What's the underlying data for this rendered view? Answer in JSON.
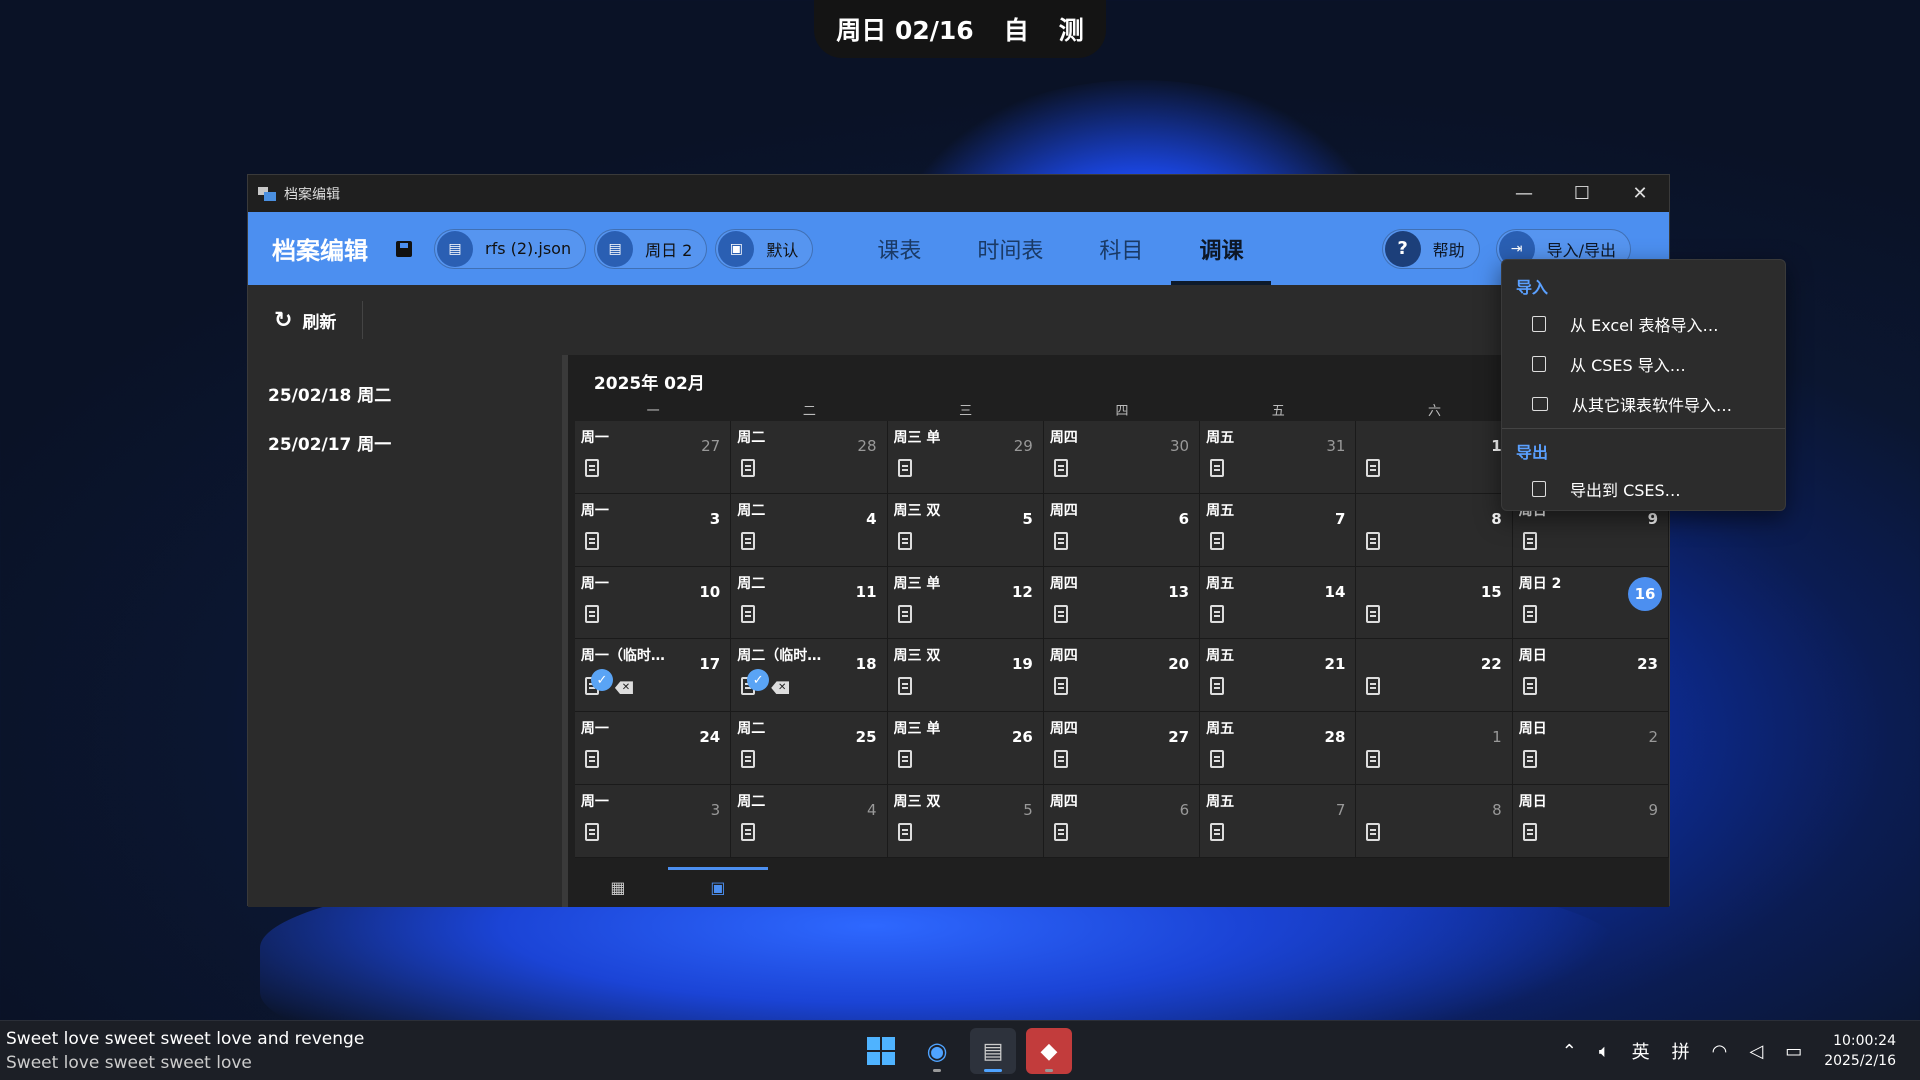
{
  "top_pill": {
    "date": "周日 02/16",
    "c1": "自",
    "c2": "测"
  },
  "window": {
    "title": "档案编辑",
    "controls": {
      "minimize": "—",
      "maximize": "☐",
      "close": "✕"
    }
  },
  "header": {
    "title": "档案编辑",
    "chips": [
      {
        "label": "rfs (2).json"
      },
      {
        "label": "周日 2"
      },
      {
        "label": "默认"
      }
    ],
    "tabs": [
      {
        "label": "课表"
      },
      {
        "label": "时间表"
      },
      {
        "label": "科目"
      },
      {
        "label": "调课"
      }
    ],
    "active_tab": "调课",
    "help": "帮助",
    "import_export": "导入/导出"
  },
  "toolbar": {
    "refresh": "刷新"
  },
  "left_list": [
    "25/02/18 周二",
    "25/02/17 周一"
  ],
  "calendar": {
    "month": "2025年 02月",
    "weekdays": [
      "一",
      "二",
      "三",
      "四",
      "五",
      "六",
      "日"
    ],
    "rows": [
      [
        {
          "label": "周一",
          "num": "27",
          "dim": true
        },
        {
          "label": "周二",
          "num": "28",
          "dim": true
        },
        {
          "label": "周三 单",
          "num": "29",
          "dim": true
        },
        {
          "label": "周四",
          "num": "30",
          "dim": true
        },
        {
          "label": "周五",
          "num": "31",
          "dim": true
        },
        {
          "label": "",
          "num": "1"
        },
        {
          "label": "",
          "num": ""
        }
      ],
      [
        {
          "label": "周一",
          "num": "3"
        },
        {
          "label": "周二",
          "num": "4"
        },
        {
          "label": "周三 双",
          "num": "5"
        },
        {
          "label": "周四",
          "num": "6"
        },
        {
          "label": "周五",
          "num": "7"
        },
        {
          "label": "",
          "num": "8"
        },
        {
          "label": "周日",
          "num": "9"
        }
      ],
      [
        {
          "label": "周一",
          "num": "10"
        },
        {
          "label": "周二",
          "num": "11"
        },
        {
          "label": "周三 单",
          "num": "12"
        },
        {
          "label": "周四",
          "num": "13"
        },
        {
          "label": "周五",
          "num": "14"
        },
        {
          "label": "",
          "num": "15"
        },
        {
          "label": "周日 2",
          "num": "16",
          "today": true
        }
      ],
      [
        {
          "label": "周一（临时…",
          "num": "17",
          "badge": true
        },
        {
          "label": "周二（临时…",
          "num": "18",
          "badge": true
        },
        {
          "label": "周三 双",
          "num": "19"
        },
        {
          "label": "周四",
          "num": "20"
        },
        {
          "label": "周五",
          "num": "21"
        },
        {
          "label": "",
          "num": "22"
        },
        {
          "label": "周日",
          "num": "23"
        }
      ],
      [
        {
          "label": "周一",
          "num": "24"
        },
        {
          "label": "周二",
          "num": "25"
        },
        {
          "label": "周三 单",
          "num": "26"
        },
        {
          "label": "周四",
          "num": "27"
        },
        {
          "label": "周五",
          "num": "28"
        },
        {
          "label": "",
          "num": "1",
          "dim": true
        },
        {
          "label": "周日",
          "num": "2",
          "dim": true
        }
      ],
      [
        {
          "label": "周一",
          "num": "3",
          "dim": true
        },
        {
          "label": "周二",
          "num": "4",
          "dim": true
        },
        {
          "label": "周三 双",
          "num": "5",
          "dim": true
        },
        {
          "label": "周四",
          "num": "6",
          "dim": true
        },
        {
          "label": "周五",
          "num": "7",
          "dim": true
        },
        {
          "label": "",
          "num": "8",
          "dim": true
        },
        {
          "label": "周日",
          "num": "9",
          "dim": true
        }
      ]
    ]
  },
  "dropdown": {
    "import_header": "导入",
    "import_items": [
      "从 Excel 表格导入…",
      "从 CSES 导入…",
      "从其它课表软件导入…"
    ],
    "export_header": "导出",
    "export_items": [
      "导出到 CSES…"
    ]
  },
  "taskbar": {
    "media_line1": "Sweet love sweet sweet love and revenge",
    "media_line2": "Sweet love sweet sweet love",
    "ime_lang": "英",
    "ime_mode": "拼",
    "time": "10:00:24",
    "date": "2025/2/16"
  },
  "colors": {
    "accent": "#4c8ff0",
    "today": "#4c8ff0"
  }
}
